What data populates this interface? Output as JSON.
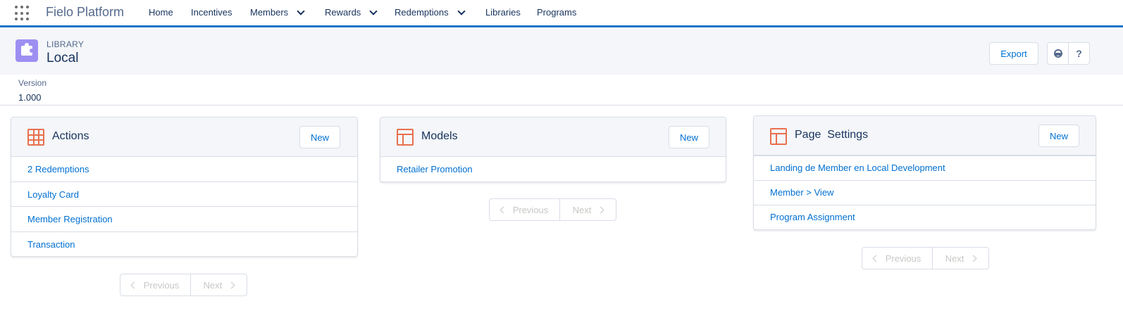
{
  "nav": {
    "app_name": "Fielo Platform",
    "items": [
      {
        "label": "Home"
      },
      {
        "label": "Incentives"
      },
      {
        "label": "Members"
      },
      {
        "label": "Rewards"
      },
      {
        "label": "Redemptions"
      },
      {
        "label": "Libraries"
      },
      {
        "label": "Programs"
      }
    ]
  },
  "header": {
    "eyebrow": "LIBRARY",
    "title": "Local",
    "export_label": "Export",
    "help_label": "?",
    "icon": "puzzle-icon"
  },
  "details": {
    "version_label": "Version",
    "version_value": "1.000"
  },
  "cards": {
    "actions": {
      "title": "Actions",
      "new_label": "New",
      "items": [
        "2 Redemptions",
        "Loyalty Card",
        "Member Registration",
        "Transaction"
      ],
      "prev_label": "Previous",
      "next_label": "Next"
    },
    "models": {
      "title": "Models",
      "new_label": "New",
      "items": [
        "Retailer Promotion"
      ],
      "prev_label": "Previous",
      "next_label": "Next"
    },
    "page_settings": {
      "title": "Page  Settings",
      "new_label": "New",
      "items": [
        "Landing de Member en Local Development",
        "Member > View",
        "Program Assignment"
      ],
      "prev_label": "Previous",
      "next_label": "Next"
    }
  },
  "colors": {
    "accent": "#0070d2",
    "nav_border": "#1d73c9",
    "card_icon": "#e8704f",
    "object_icon": "#9d8ff2"
  }
}
